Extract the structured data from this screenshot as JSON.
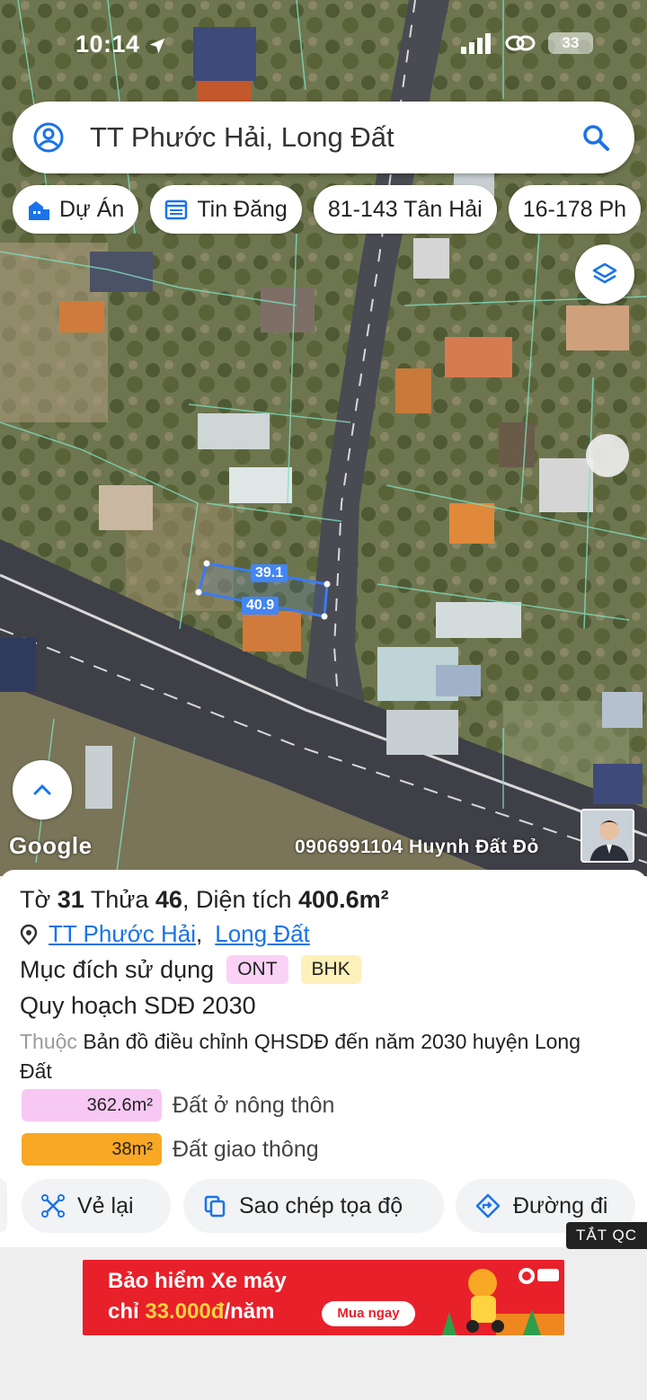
{
  "status": {
    "time": "10:14",
    "battery": "33"
  },
  "search": {
    "query": "TT Phước Hải, Long Đất"
  },
  "chips": [
    {
      "label": "Dự Án",
      "icon": "building-icon"
    },
    {
      "label": "Tin Đăng",
      "icon": "calendar-list-icon"
    },
    {
      "label": "81-143 Tân Hải"
    },
    {
      "label": "16-178 Ph"
    }
  ],
  "map": {
    "measure_top": "39.1",
    "measure_bottom": "40.9",
    "google_logo": "Google",
    "watermark": "0906991104 Huynh Đất Đỏ"
  },
  "parcel": {
    "to_label": "Tờ",
    "to_value": "31",
    "thua_label": "Thửa",
    "thua_value": "46",
    "area_label": ", Diện tích",
    "area_value": "400.6m²",
    "location_1": "TT Phước Hải",
    "location_sep": ",",
    "location_2": "Long Đất",
    "usage_label": "Mục đích sử dụng",
    "usage_tags": [
      "ONT",
      "BHK"
    ],
    "plan_title": "Quy hoạch SDĐ 2030",
    "plan_prefix": "Thuộc",
    "plan_desc": "Bản đồ điều chỉnh QHSDĐ đến năm 2030 huyện Long Đất",
    "zones": [
      {
        "area": "362.6m²",
        "label": "Đất ở nông thôn",
        "color": "#f8c8f4"
      },
      {
        "area": "38m²",
        "label": "Đất giao thông",
        "color": "#f9a825"
      }
    ]
  },
  "actions": [
    {
      "label": "Vẻ lại",
      "icon": "redraw-icon"
    },
    {
      "label": "Sao chép tọa độ",
      "icon": "copy-icon"
    },
    {
      "label": "Đường đi",
      "icon": "directions-icon"
    }
  ],
  "ad_toggle": "TẮT QC",
  "ad": {
    "line1": "Bảo hiểm Xe máy",
    "line2_prefix": "chỉ",
    "line2_price": "33.000đ",
    "line2_suffix": "/năm",
    "button": "Mua ngay"
  },
  "colors": {
    "accent": "#1a73e8",
    "ad_red": "#e8202a",
    "parcel_blue": "#4285f4"
  }
}
